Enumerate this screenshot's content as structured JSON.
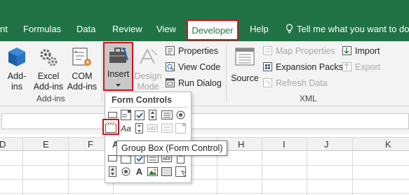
{
  "tabs": {
    "insert_partial": "nt",
    "formulas": "Formulas",
    "data": "Data",
    "review": "Review",
    "view": "View",
    "developer": "Developer",
    "help": "Help",
    "tell_me": "Tell me what you want to do"
  },
  "ribbon": {
    "addins_group": {
      "label": "Add-ins",
      "addins_btn": [
        "Add-",
        "ins"
      ],
      "excel_addins_btn": [
        "Excel",
        "Add-ins"
      ],
      "com_addins_btn": [
        "COM",
        "Add-ins"
      ]
    },
    "controls_group": {
      "insert_btn": "Insert",
      "design_mode_btn": [
        "Design",
        "Mode"
      ],
      "properties": "Properties",
      "view_code": "View Code",
      "run_dialog": "Run Dialog"
    },
    "xml_group": {
      "label": "XML",
      "source": "Source",
      "map_properties": "Map Properties",
      "expansion_packs": "Expansion Packs",
      "refresh_data": "Refresh Data",
      "import": "Import",
      "export": "Export"
    }
  },
  "grid": {
    "columns": [
      "D",
      "E",
      "F",
      "G",
      "H",
      "I",
      "J",
      "K"
    ]
  },
  "form_controls": {
    "title": "Form Controls",
    "label_glyph": "Aa",
    "groupbox_glyph": "XYZ",
    "textfield_glyph": "abl",
    "tooltip": "Group Box (Form Control)",
    "activex_partial": "A",
    "activex_label_glyph": "A"
  },
  "colors": {
    "accent_green": "#217346",
    "highlight_red": "#d0121b"
  }
}
